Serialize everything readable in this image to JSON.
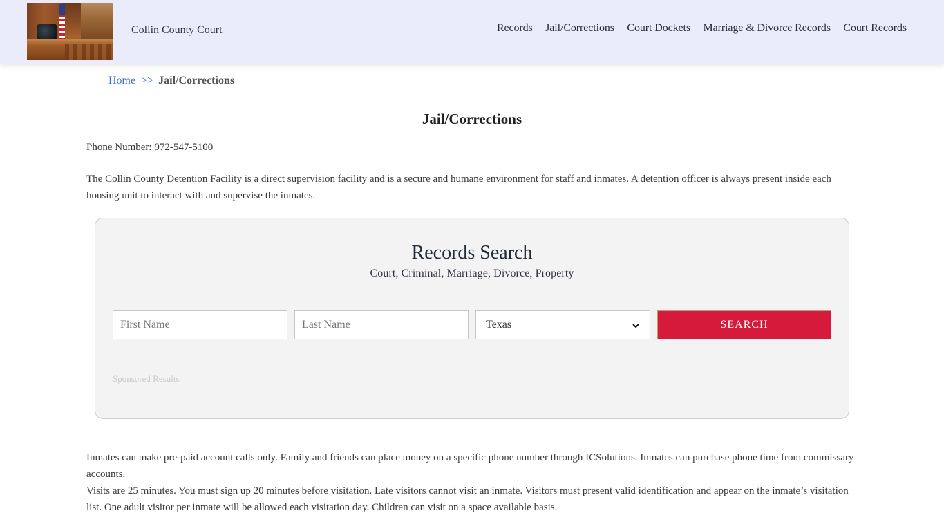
{
  "header": {
    "site_title": "Collin County Court",
    "logo_alt": "Courtroom judge bench",
    "nav": [
      {
        "label": "Records"
      },
      {
        "label": "Jail/Corrections"
      },
      {
        "label": "Court Dockets"
      },
      {
        "label": "Marriage & Divorce Records"
      },
      {
        "label": "Court Records"
      }
    ]
  },
  "breadcrumb": {
    "home": "Home",
    "separator": ">>",
    "current": "Jail/Corrections"
  },
  "page": {
    "title": "Jail/Corrections",
    "phone": "Phone Number: 972-547-5100",
    "intro": "The Collin County Detention Facility is a direct supervision facility and is a secure and humane environment for staff and inmates. A detention officer is always present inside each housing unit to interact with and supervise the inmates.",
    "calls": "Inmates can make pre-paid account calls only. Family and friends can place money on a specific phone number through ICSolutions. Inmates can purchase phone time from commissary accounts.",
    "visits": "Visits are 25 minutes. You must sign up 20 minutes before visitation. Late visitors cannot visit an inmate. Visitors must present valid identification and appear on the inmate’s visitation list. One adult visitor per inmate will be allowed each visitation day. Children can visit on a space available basis."
  },
  "search": {
    "title": "Records Search",
    "subtitle": "Court, Criminal, Marriage, Divorce, Property",
    "first_name_placeholder": "First Name",
    "first_name_value": "",
    "last_name_placeholder": "Last Name",
    "last_name_value": "",
    "state_selected": "Texas",
    "button_label": "SEARCH",
    "sponsored_label": "Sponsored Results"
  },
  "colors": {
    "header_bg": "#eaebfb",
    "link": "#3d6bd4",
    "search_button": "#d61a3c",
    "search_box_bg": "#f3f3f3"
  }
}
